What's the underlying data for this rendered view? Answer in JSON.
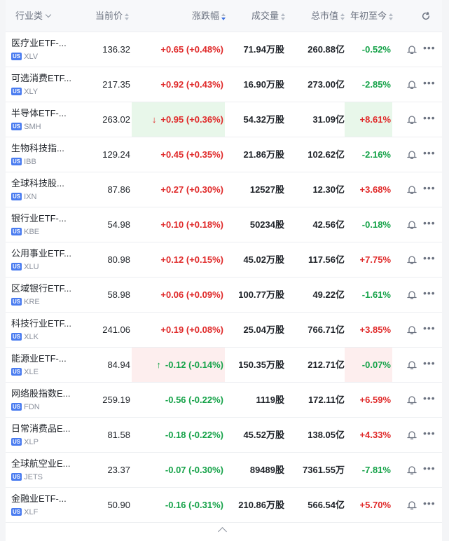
{
  "header": {
    "sector": "行业类",
    "price": "当前价",
    "change": "涨跌幅",
    "volume": "成交量",
    "market_cap": "总市值",
    "ytd": "年初至今"
  },
  "market_badge": "US",
  "rows": [
    {
      "name": "医疗业ETF-...",
      "ticker": "XLV",
      "price": "136.32",
      "change": "+0.65 (+0.48%)",
      "change_dir": "up",
      "volume": "71.94万股",
      "market_cap": "260.88亿",
      "ytd": "-0.52%",
      "ytd_dir": "down"
    },
    {
      "name": "可选消费ETF...",
      "ticker": "XLY",
      "price": "217.35",
      "change": "+0.92 (+0.43%)",
      "change_dir": "up",
      "volume": "16.90万股",
      "market_cap": "273.00亿",
      "ytd": "-2.85%",
      "ytd_dir": "down"
    },
    {
      "name": "半导体ETF-...",
      "ticker": "SMH",
      "price": "263.02",
      "change": "+0.95 (+0.36%)",
      "change_dir": "up",
      "change_arrow": "↓",
      "highlight": "green",
      "volume": "54.32万股",
      "market_cap": "31.09亿",
      "ytd": "+8.61%",
      "ytd_dir": "up"
    },
    {
      "name": "生物科技指...",
      "ticker": "IBB",
      "price": "129.24",
      "change": "+0.45 (+0.35%)",
      "change_dir": "up",
      "volume": "21.86万股",
      "market_cap": "102.62亿",
      "ytd": "-2.16%",
      "ytd_dir": "down"
    },
    {
      "name": "全球科技股...",
      "ticker": "IXN",
      "price": "87.86",
      "change": "+0.27 (+0.30%)",
      "change_dir": "up",
      "volume": "12527股",
      "market_cap": "12.30亿",
      "ytd": "+3.68%",
      "ytd_dir": "up"
    },
    {
      "name": "银行业ETF-...",
      "ticker": "KBE",
      "price": "54.98",
      "change": "+0.10 (+0.18%)",
      "change_dir": "up",
      "volume": "50234股",
      "market_cap": "42.56亿",
      "ytd": "-0.18%",
      "ytd_dir": "down"
    },
    {
      "name": "公用事业ETF...",
      "ticker": "XLU",
      "price": "80.98",
      "change": "+0.12 (+0.15%)",
      "change_dir": "up",
      "volume": "45.02万股",
      "market_cap": "117.56亿",
      "ytd": "+7.75%",
      "ytd_dir": "up"
    },
    {
      "name": "区域银行ETF...",
      "ticker": "KRE",
      "price": "58.98",
      "change": "+0.06 (+0.09%)",
      "change_dir": "up",
      "volume": "100.77万股",
      "market_cap": "49.22亿",
      "ytd": "-1.61%",
      "ytd_dir": "down"
    },
    {
      "name": "科技行业ETF...",
      "ticker": "XLK",
      "price": "241.06",
      "change": "+0.19 (+0.08%)",
      "change_dir": "up",
      "volume": "25.04万股",
      "market_cap": "766.71亿",
      "ytd": "+3.85%",
      "ytd_dir": "up"
    },
    {
      "name": "能源业ETF-...",
      "ticker": "XLE",
      "price": "84.94",
      "change": "-0.12 (-0.14%)",
      "change_dir": "down",
      "change_arrow": "↑",
      "highlight": "red",
      "volume": "150.35万股",
      "market_cap": "212.71亿",
      "ytd": "-0.07%",
      "ytd_dir": "down"
    },
    {
      "name": "网络股指数E...",
      "ticker": "FDN",
      "price": "259.19",
      "change": "-0.56 (-0.22%)",
      "change_dir": "down",
      "volume": "1119股",
      "market_cap": "172.11亿",
      "ytd": "+6.59%",
      "ytd_dir": "up"
    },
    {
      "name": "日常消费品E...",
      "ticker": "XLP",
      "price": "81.58",
      "change": "-0.18 (-0.22%)",
      "change_dir": "down",
      "volume": "45.52万股",
      "market_cap": "138.05亿",
      "ytd": "+4.33%",
      "ytd_dir": "up"
    },
    {
      "name": "全球航空业E...",
      "ticker": "JETS",
      "price": "23.37",
      "change": "-0.07 (-0.30%)",
      "change_dir": "down",
      "volume": "89489股",
      "market_cap": "7361.55万",
      "ytd": "-7.81%",
      "ytd_dir": "down"
    },
    {
      "name": "金融业ETF-...",
      "ticker": "XLF",
      "price": "50.90",
      "change": "-0.16 (-0.31%)",
      "change_dir": "down",
      "volume": "210.86万股",
      "market_cap": "566.54亿",
      "ytd": "+5.70%",
      "ytd_dir": "up"
    }
  ],
  "colors": {
    "up": "#e02b2b",
    "down": "#17a34a",
    "accent": "#3b6fe0"
  },
  "icons": {
    "refresh": "refresh-icon",
    "alert": "bell-icon",
    "more": "more-icon",
    "collapse": "chevron-up-icon"
  }
}
